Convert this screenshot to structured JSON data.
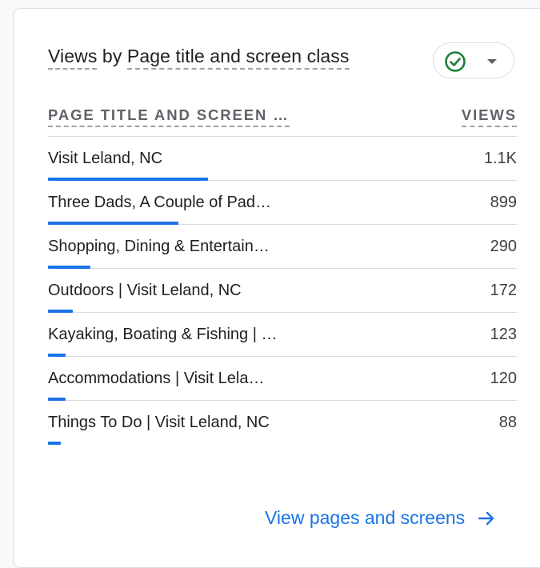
{
  "card": {
    "title_metric": "Views",
    "title_connector": " by ",
    "title_dimension": "Page title and screen class",
    "status_icon": "check-circle-icon",
    "dropdown_icon": "caret-down-icon"
  },
  "table": {
    "col_dimension": "PAGE TITLE AND SCREEN …",
    "col_metric": "VIEWS",
    "max_value": 1100,
    "rows": [
      {
        "name": "Visit Leland, NC",
        "value_label": "1.1K",
        "value": 1100
      },
      {
        "name": "Three Dads, A Couple of Pad…",
        "value_label": "899",
        "value": 899
      },
      {
        "name": "Shopping, Dining & Entertain…",
        "value_label": "290",
        "value": 290
      },
      {
        "name": "Outdoors | Visit Leland, NC",
        "value_label": "172",
        "value": 172
      },
      {
        "name": "Kayaking, Boating & Fishing | …",
        "value_label": "123",
        "value": 123
      },
      {
        "name": "Accommodations | Visit Lela…",
        "value_label": "120",
        "value": 120
      },
      {
        "name": "Things To Do | Visit Leland, NC",
        "value_label": "88",
        "value": 88
      }
    ]
  },
  "footer": {
    "link_label": "View pages and screens",
    "link_icon": "arrow-right-icon"
  },
  "colors": {
    "accent": "#1a73e8",
    "success": "#188038",
    "text": "#202124",
    "muted": "#5f6368",
    "divider": "#dadce0"
  }
}
